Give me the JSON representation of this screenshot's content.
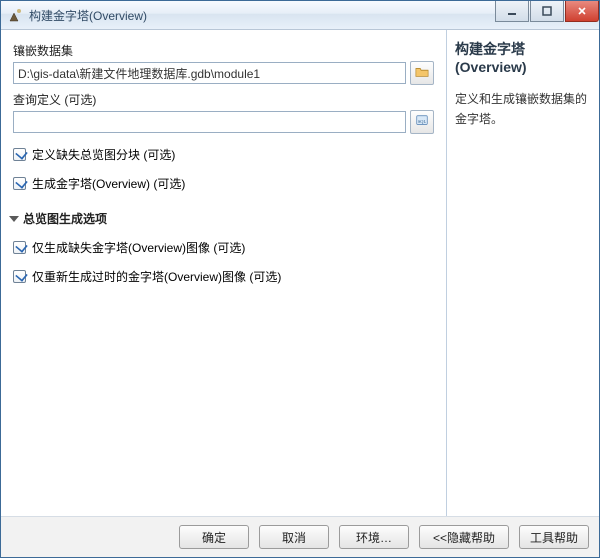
{
  "window": {
    "title": "构建金字塔(Overview)"
  },
  "form": {
    "mosaic_label": "镶嵌数据集",
    "mosaic_value": "D:\\gis-data\\新建文件地理数据库.gdb\\module1",
    "query_label": "查询定义 (可选)",
    "query_value": "",
    "checkbox1": "定义缺失总览图分块 (可选)",
    "checkbox2": "生成金字塔(Overview) (可选)",
    "section": "总览图生成选项",
    "checkbox3": "仅生成缺失金字塔(Overview)图像 (可选)",
    "checkbox4": "仅重新生成过时的金字塔(Overview)图像 (可选)"
  },
  "help": {
    "title": "构建金字塔 (Overview)",
    "desc": "定义和生成镶嵌数据集的金字塔。"
  },
  "buttons": {
    "ok": "确定",
    "cancel": "取消",
    "env": "环境…",
    "hide_help": "<<隐藏帮助",
    "tool_help": "工具帮助"
  }
}
